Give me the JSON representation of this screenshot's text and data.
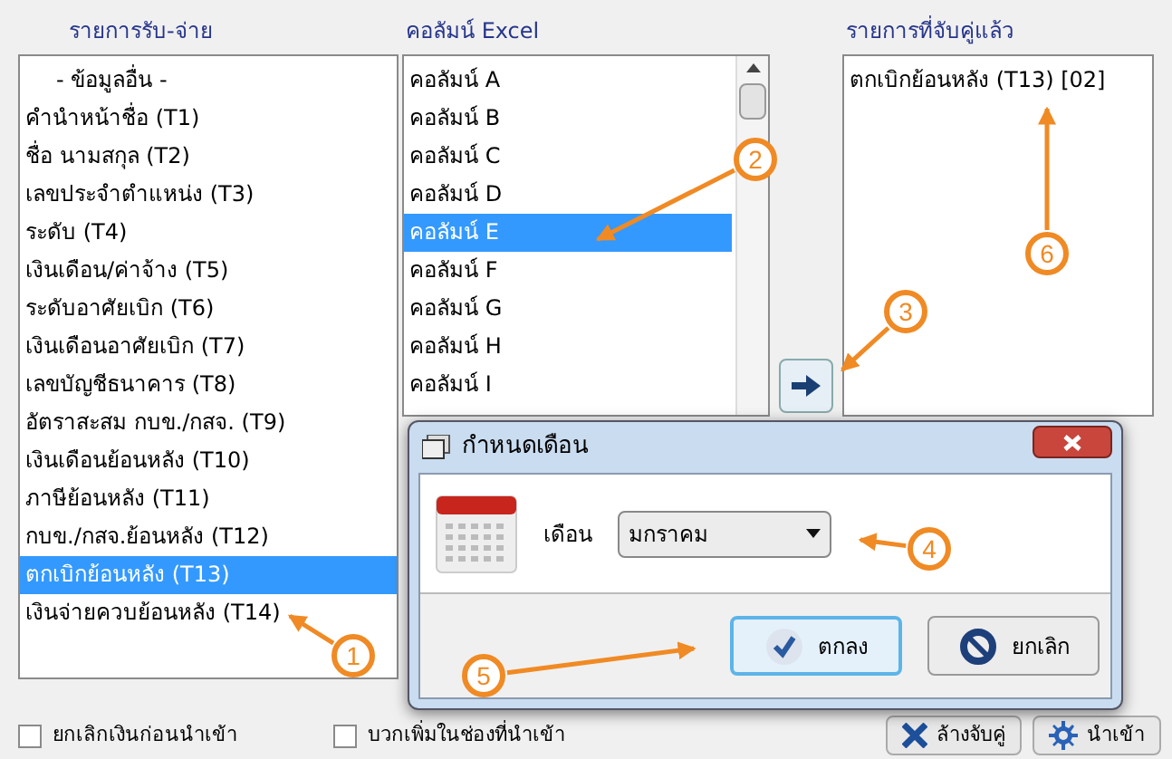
{
  "source_list": {
    "title": "รายการรับ-จ่าย",
    "items": [
      {
        "label": "- ข้อมูลอื่น -",
        "selected": false,
        "kind": "group"
      },
      {
        "label": "คำนำหน้าชื่อ (T1)",
        "selected": false,
        "kind": "item"
      },
      {
        "label": "ชื่อ นามสกุล (T2)",
        "selected": false,
        "kind": "item"
      },
      {
        "label": "เลขประจำตำแหน่ง (T3)",
        "selected": false,
        "kind": "item"
      },
      {
        "label": "ระดับ (T4)",
        "selected": false,
        "kind": "item"
      },
      {
        "label": "เงินเดือน/ค่าจ้าง (T5)",
        "selected": false,
        "kind": "item"
      },
      {
        "label": "ระดับอาศัยเบิก (T6)",
        "selected": false,
        "kind": "item"
      },
      {
        "label": "เงินเดือนอาศัยเบิก (T7)",
        "selected": false,
        "kind": "item"
      },
      {
        "label": "เลขบัญชีธนาคาร (T8)",
        "selected": false,
        "kind": "item"
      },
      {
        "label": "อัตราสะสม กบข./กสจ. (T9)",
        "selected": false,
        "kind": "item"
      },
      {
        "label": "เงินเดือนย้อนหลัง (T10)",
        "selected": false,
        "kind": "item"
      },
      {
        "label": "ภาษีย้อนหลัง (T11)",
        "selected": false,
        "kind": "item"
      },
      {
        "label": "กบข./กสจ.ย้อนหลัง (T12)",
        "selected": false,
        "kind": "item"
      },
      {
        "label": "ตกเบิกย้อนหลัง (T13)",
        "selected": true,
        "kind": "item"
      },
      {
        "label": "เงินจ่ายควบย้อนหลัง (T14)",
        "selected": false,
        "kind": "item"
      }
    ]
  },
  "excel_columns": {
    "title": "คอลัมน์ Excel",
    "items": [
      {
        "label": "คอลัมน์ A",
        "selected": false
      },
      {
        "label": "คอลัมน์ B",
        "selected": false
      },
      {
        "label": "คอลัมน์ C",
        "selected": false
      },
      {
        "label": "คอลัมน์ D",
        "selected": false
      },
      {
        "label": "คอลัมน์ E",
        "selected": true
      },
      {
        "label": "คอลัมน์ F",
        "selected": false
      },
      {
        "label": "คอลัมน์ G",
        "selected": false
      },
      {
        "label": "คอลัมน์ H",
        "selected": false
      },
      {
        "label": "คอลัมน์ I",
        "selected": false
      }
    ]
  },
  "matched_list": {
    "title": "รายการที่จับคู่แล้ว",
    "items": [
      {
        "label": "ตกเบิกย้อนหลัง (T13) [02]",
        "selected": false
      }
    ]
  },
  "options": [
    {
      "label": "ยกเลิกเงินก่อนนำเข้า",
      "checked": false
    },
    {
      "label": "บวกเพิ่มในช่องที่นำเข้า",
      "checked": false
    }
  ],
  "buttons": [
    {
      "label": "ล้างจับคู่",
      "kind": "clear"
    },
    {
      "label": "นำเข้า",
      "kind": "import"
    }
  ],
  "dialog": {
    "title": "กำหนดเดือน",
    "field_label": "เดือน",
    "month": "มกราคม",
    "buttons": [
      {
        "label": "ตกลง",
        "kind": "ok"
      },
      {
        "label": "ยกเลิก",
        "kind": "cancel"
      }
    ]
  },
  "annotations": [
    {
      "label": "1"
    },
    {
      "label": "2"
    },
    {
      "label": "3"
    },
    {
      "label": "4"
    },
    {
      "label": "5"
    },
    {
      "label": "6"
    }
  ]
}
